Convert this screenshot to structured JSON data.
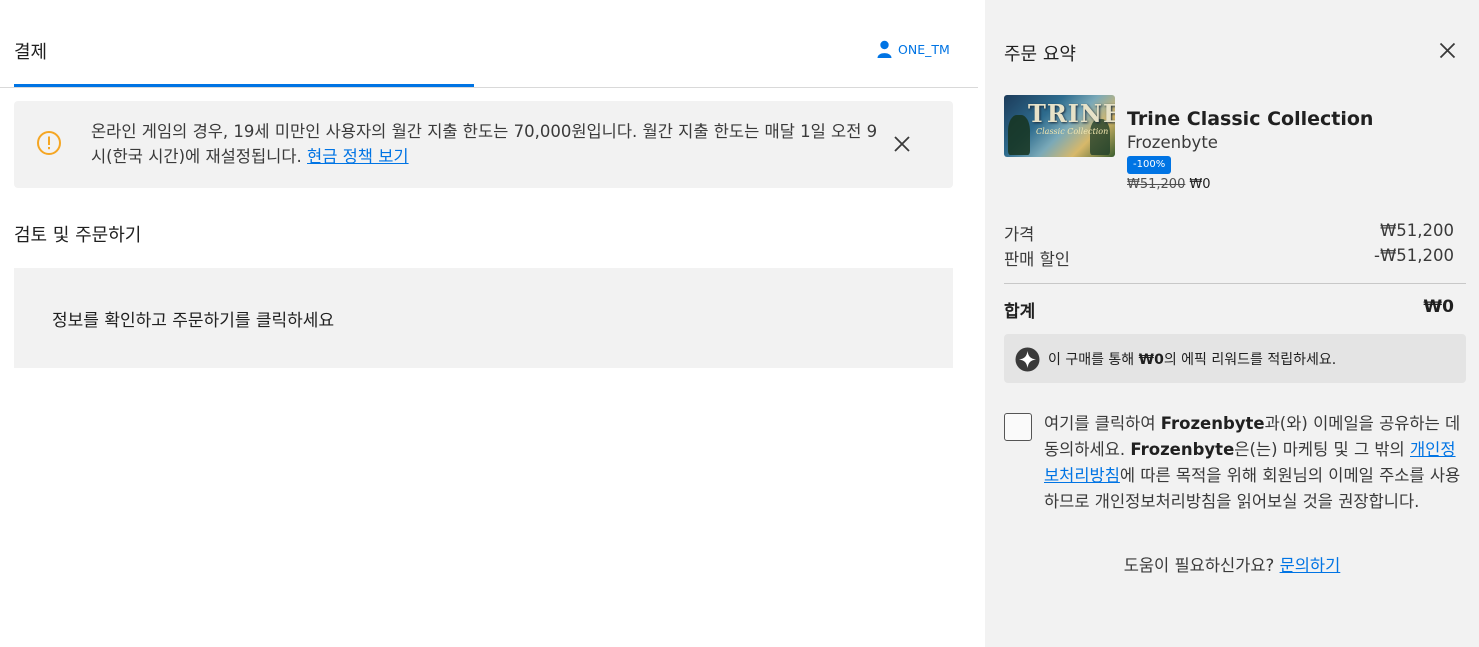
{
  "header": {
    "tab_label": "결제",
    "username": "ONE_TM",
    "colors": {
      "accent": "#0074e4",
      "warning": "#f5a623"
    }
  },
  "alert": {
    "icon": "warning-circle-icon",
    "message": "온라인 게임의 경우, 19세 미만인 사용자의 월간 지출 한도는 70,000원입니다. 월간 지출 한도는 매달 1일 오전 9시(한국 시간)에 재설정됩니다. ",
    "link_label": "현금 정책 보기"
  },
  "review": {
    "title": "검토 및 주문하기",
    "instruction": "정보를 확인하고 주문하기를 클릭하세요"
  },
  "summary": {
    "title": "주문 요약",
    "product": {
      "thumbnail_text": "TRINE",
      "thumbnail_subtext": "Classic Collection",
      "name": "Trine Classic Collection",
      "publisher": "Frozenbyte",
      "discount_badge": "-100%",
      "original_price": "₩51,200",
      "final_price": "₩0"
    },
    "price_label": "가격",
    "price_value": "₩51,200",
    "discount_label": "판매 할인",
    "discount_value": "-₩51,200",
    "total_label": "합계",
    "total_value": "₩0",
    "reward": {
      "prefix": "이 구매를 통해 ",
      "amount": "₩0",
      "suffix": "의 에픽 리워드를 적립하세요."
    },
    "consent": {
      "part1": "여기를 클릭하여 ",
      "publisher1": "Frozenbyte",
      "part2": "과(와) 이메일을 공유하는 데 동의하세요. ",
      "publisher2": "Frozenbyte",
      "part3": "은(는) 마케팅 및 그 밖의 ",
      "policy_link": "개인정보처리방침",
      "part4": "에 따른 목적을 위해 회원님의 이메일 주소를 사용하므로 개인정보처리방침을 읽어보실 것을 권장합니다."
    },
    "help": {
      "text": "도움이 필요하신가요? ",
      "link_label": "문의하기"
    }
  }
}
